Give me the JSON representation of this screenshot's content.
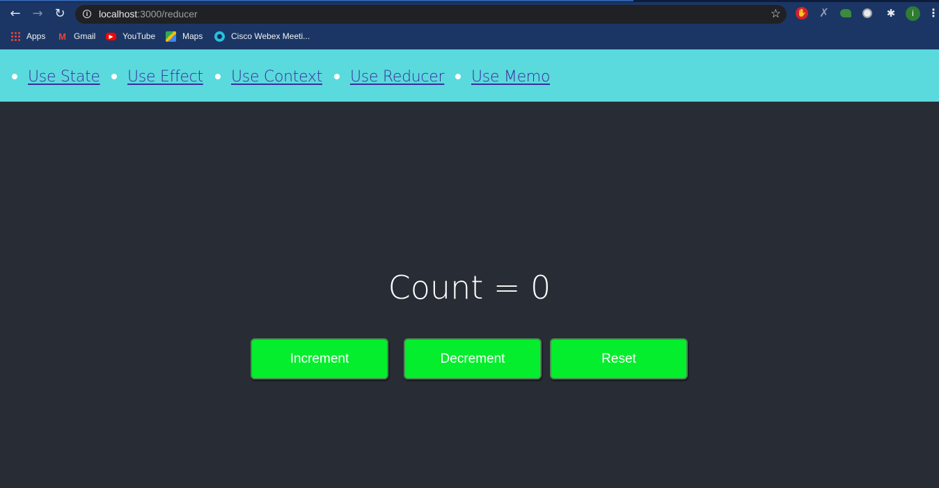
{
  "browser": {
    "url_host": "localhost",
    "url_rest": ":3000/reducer",
    "profile_initial": "i",
    "bookmarks": [
      {
        "label": "Apps",
        "icon": "apps-grid-icon"
      },
      {
        "label": "Gmail",
        "icon": "gmail-icon"
      },
      {
        "label": "YouTube",
        "icon": "youtube-icon"
      },
      {
        "label": "Maps",
        "icon": "maps-icon"
      },
      {
        "label": "Cisco Webex Meeti...",
        "icon": "webex-icon"
      }
    ]
  },
  "nav": {
    "items": [
      {
        "label": "Use State"
      },
      {
        "label": "Use Effect"
      },
      {
        "label": "Use Context"
      },
      {
        "label": "Use Reducer"
      },
      {
        "label": "Use Memo"
      }
    ]
  },
  "counter": {
    "display": "Count = 0",
    "buttons": {
      "increment": "Increment",
      "decrement": "Decrement",
      "reset": "Reset"
    }
  },
  "colors": {
    "nav_background": "#5adadd",
    "page_background": "#282c34",
    "button_background": "#05ee2d",
    "link_color": "#3b2b9e"
  }
}
